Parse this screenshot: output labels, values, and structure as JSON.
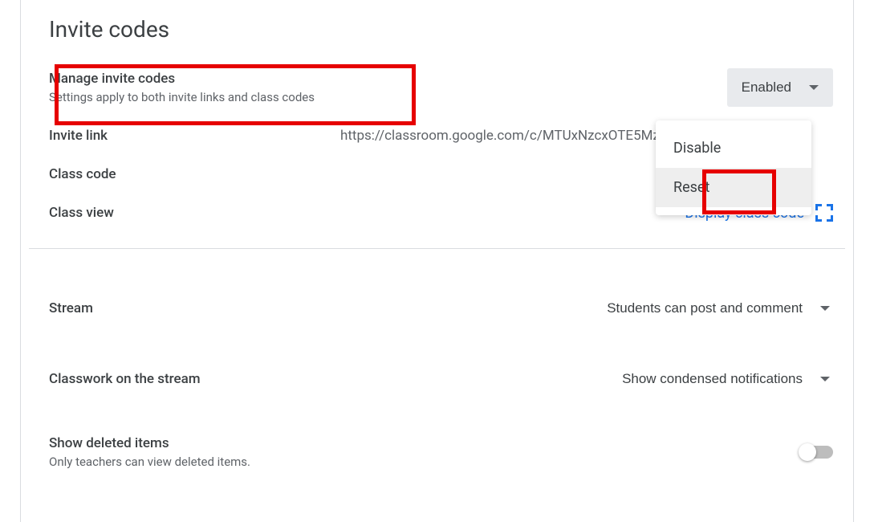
{
  "section_title": "Invite codes",
  "manage": {
    "title": "Manage invite codes",
    "subtitle": "Settings apply to both invite links and class codes",
    "dropdown_label": "Enabled",
    "menu": {
      "disable": "Disable",
      "reset": "Reset"
    }
  },
  "invite_link": {
    "label": "Invite link",
    "value": "https://classroom.google.com/c/MTUxNzcxOTE5Mz"
  },
  "class_code": {
    "label": "Class code"
  },
  "class_view": {
    "label": "Class view",
    "action": "Display class code"
  },
  "stream": {
    "label": "Stream",
    "value": "Students can post and comment"
  },
  "classwork": {
    "label": "Classwork on the stream",
    "value": "Show condensed notifications"
  },
  "deleted": {
    "label": "Show deleted items",
    "sublabel": "Only teachers can view deleted items."
  }
}
